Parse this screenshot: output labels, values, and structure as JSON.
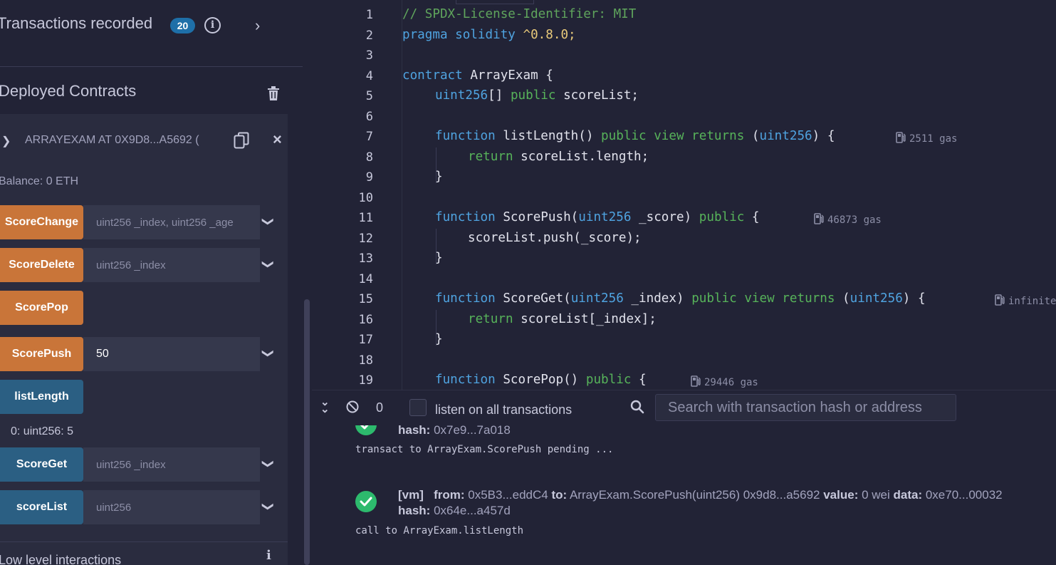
{
  "left_panel": {
    "transactions_label": "Transactions recorded",
    "transactions_count": "20",
    "info_glyph": "i",
    "deployed_title": "Deployed Contracts",
    "instance": {
      "name": "ARRAYEXAM AT 0X9D8...A5692 (",
      "balance": "Balance: 0 ETH",
      "functions": [
        {
          "label": "ScoreChange",
          "kind": "transact",
          "placeholder": "uint256 _index, uint256 _age",
          "value": "",
          "has_input": true
        },
        {
          "label": "ScoreDelete",
          "kind": "transact",
          "placeholder": "uint256 _index",
          "value": "",
          "has_input": true
        },
        {
          "label": "ScorePop",
          "kind": "transact",
          "placeholder": "",
          "value": "",
          "has_input": false
        },
        {
          "label": "ScorePush",
          "kind": "transact",
          "placeholder": "",
          "value": "50",
          "has_input": true
        },
        {
          "label": "listLength",
          "kind": "call",
          "placeholder": "",
          "value": "",
          "has_input": false
        },
        {
          "label": "ScoreGet",
          "kind": "call",
          "placeholder": "uint256 _index",
          "value": "",
          "has_input": true
        },
        {
          "label": "scoreList",
          "kind": "call",
          "placeholder": "uint256",
          "value": "",
          "has_input": true
        }
      ],
      "list_length_result": "0: uint256: 5"
    },
    "low_level_label": "Low level interactions"
  },
  "editor": {
    "line_numbers": [
      "1",
      "2",
      "3",
      "4",
      "5",
      "6",
      "7",
      "8",
      "9",
      "10",
      "11",
      "12",
      "13",
      "14",
      "15",
      "16",
      "17",
      "18",
      "19"
    ],
    "gas_hints": {
      "listLength": "2511 gas",
      "ScorePush": "46873 gas",
      "ScoreGet": "infinite",
      "ScorePop": "29446 gas"
    },
    "code": {
      "l1": "// SPDX-License-Identifier: MIT",
      "l2_kw": "pragma solidity",
      "l2_ver": " ^0.8.0;",
      "l4_kw": "contract",
      "l4_rest": " ArrayExam {",
      "l5_type": "uint256",
      "l5_br": "[] ",
      "l5_pub": "public",
      "l5_rest": " scoreList;",
      "l7_fn": "function",
      "l7_name": " listLength() ",
      "l7_mods": "public view returns",
      "l7_open": " (",
      "l7_type": "uint256",
      "l7_close": ") {",
      "l8_ret": "return",
      "l8_rest": " scoreList.length;",
      "close_brace": "}",
      "l11_fn": "function",
      "l11_name": " ScorePush(",
      "l11_type": "uint256",
      "l11_arg": " _score) ",
      "l11_pub": "public",
      "l11_open": " {",
      "l12": "scoreList.push(_score);",
      "l15_fn": "function",
      "l15_name": " ScoreGet(",
      "l15_type": "uint256",
      "l15_arg": " _index) ",
      "l15_mods": "public view returns",
      "l15_open": " (",
      "l15_type2": "uint256",
      "l15_close": ") {",
      "l16_ret": "return",
      "l16_rest": " scoreList[_index];",
      "l19_fn": "function",
      "l19_name": " ScorePop() ",
      "l19_pub": "public",
      "l19_open": " {"
    }
  },
  "terminal": {
    "pending_count": "0",
    "listen_label": "listen on all transactions",
    "search_placeholder": "Search with transaction hash or address",
    "entry1": {
      "hash_label": "hash:",
      "hash_value": " 0x7e9...7a018",
      "message": "transact to ArrayExam.ScorePush pending ..."
    },
    "entry2": {
      "tag": "[vm]",
      "from_label": "from:",
      "from_value": " 0x5B3...eddC4 ",
      "to_label": "to:",
      "to_value": " ArrayExam.ScorePush(uint256) 0x9d8...a5692 ",
      "value_label": "value:",
      "value_value": " 0 wei ",
      "data_label": "data:",
      "data_value": " 0xe70...00032",
      "hash_label": "hash:",
      "hash_value": " 0x64e...a457d",
      "message": "call to ArrayExam.listLength"
    }
  },
  "colors": {
    "transact_button": "#c97539",
    "call_button": "#2b5f83",
    "badge": "#1e6fa8",
    "success": "#2dba6d",
    "background": "#222336"
  },
  "icons": [
    "info-icon",
    "chevron-right-icon",
    "trash-icon",
    "chevron-down-icon",
    "copy-icon",
    "close-icon",
    "gas-pump-icon",
    "double-chevron-down-icon",
    "ban-icon",
    "search-icon",
    "success-check-icon"
  ]
}
